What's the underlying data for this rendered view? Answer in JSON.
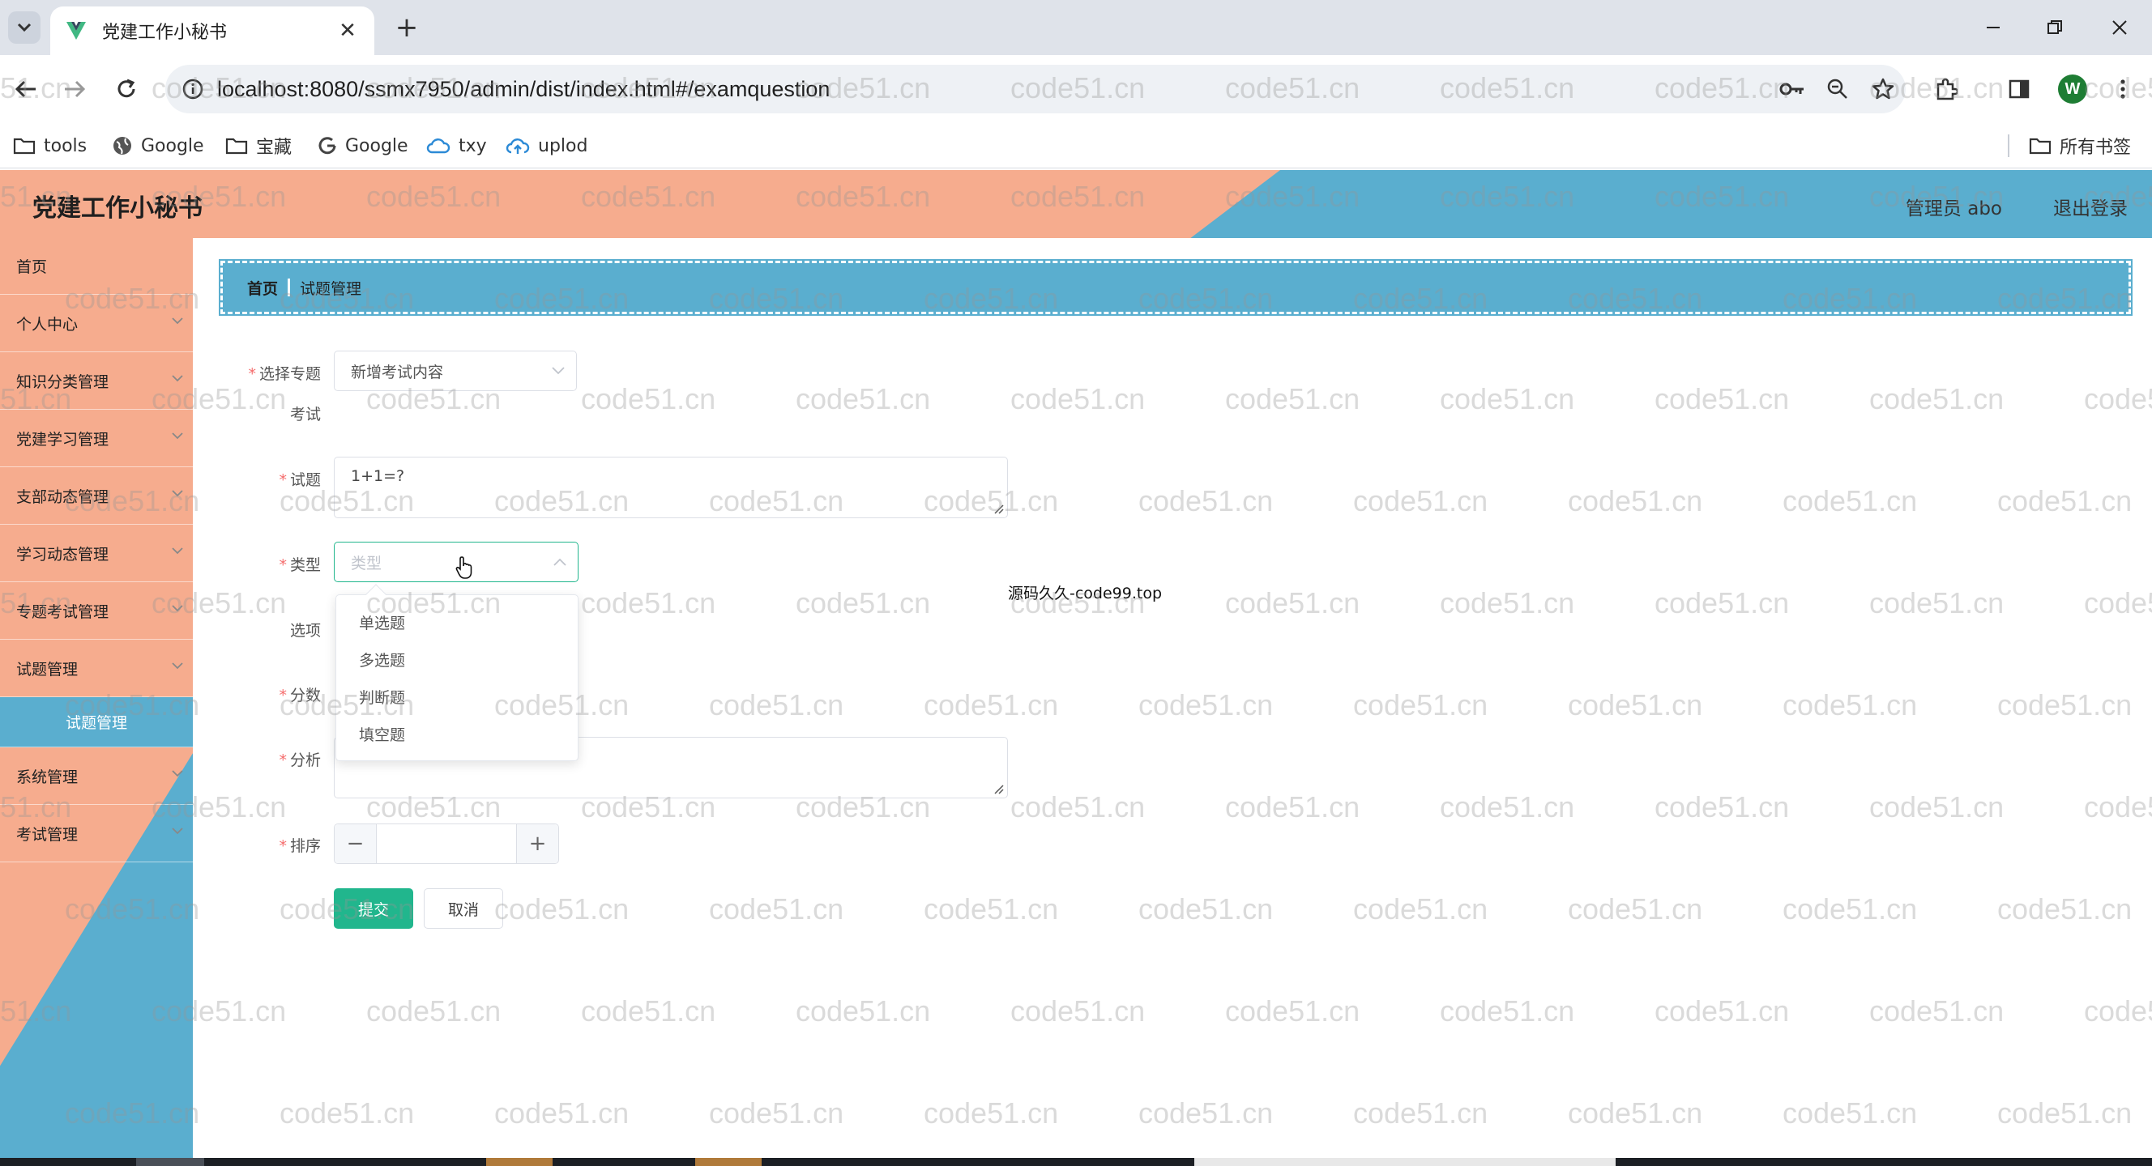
{
  "browser": {
    "tab_title": "党建工作小秘书",
    "url": "localhost:8080/ssmx7950/admin/dist/index.html#/examquestion",
    "bookmarks": [
      {
        "label": "tools",
        "icon": "folder-icon"
      },
      {
        "label": "Google",
        "icon": "globe-icon"
      },
      {
        "label": "宝藏",
        "icon": "folder-icon"
      },
      {
        "label": "Google",
        "icon": "google-g-icon"
      },
      {
        "label": "txy",
        "icon": "cloud-icon"
      },
      {
        "label": "uplod",
        "icon": "cloud-upload-icon"
      }
    ],
    "all_bookmarks": "所有书签",
    "avatar_letter": "W"
  },
  "header": {
    "app_title": "党建工作小秘书",
    "user": "管理员 abo",
    "logout": "退出登录"
  },
  "sidebar": {
    "items": [
      {
        "label": "首页"
      },
      {
        "label": "个人中心"
      },
      {
        "label": "知识分类管理"
      },
      {
        "label": "党建学习管理"
      },
      {
        "label": "支部动态管理"
      },
      {
        "label": "学习动态管理"
      },
      {
        "label": "专题考试管理"
      },
      {
        "label": "试题管理"
      }
    ],
    "active_sub": "试题管理",
    "items_after": [
      {
        "label": "系统管理"
      },
      {
        "label": "考试管理"
      }
    ]
  },
  "breadcrumb": {
    "home": "首页",
    "current": "试题管理"
  },
  "form": {
    "exam_label_line1": "选择专题",
    "exam_label_line2": "考试",
    "exam_value": "新增考试内容",
    "question_label": "试题",
    "question_value": "1+1=?",
    "type_label": "类型",
    "type_placeholder": "类型",
    "options_label": "选项",
    "score_label": "分数",
    "analysis_label": "分析",
    "sort_label": "排序",
    "type_options": [
      "单选题",
      "多选题",
      "判断题",
      "填空题"
    ],
    "stepper_minus": "−",
    "stepper_plus": "+",
    "submit": "提交",
    "cancel": "取消"
  },
  "overlay_note": "源码久久-code99.top",
  "watermark_text": "code51.cn",
  "colors": {
    "salmon": "#f6ac8e",
    "blue": "#5aaecf",
    "submit_green": "#21b68d",
    "required_red": "#f56c6c"
  }
}
